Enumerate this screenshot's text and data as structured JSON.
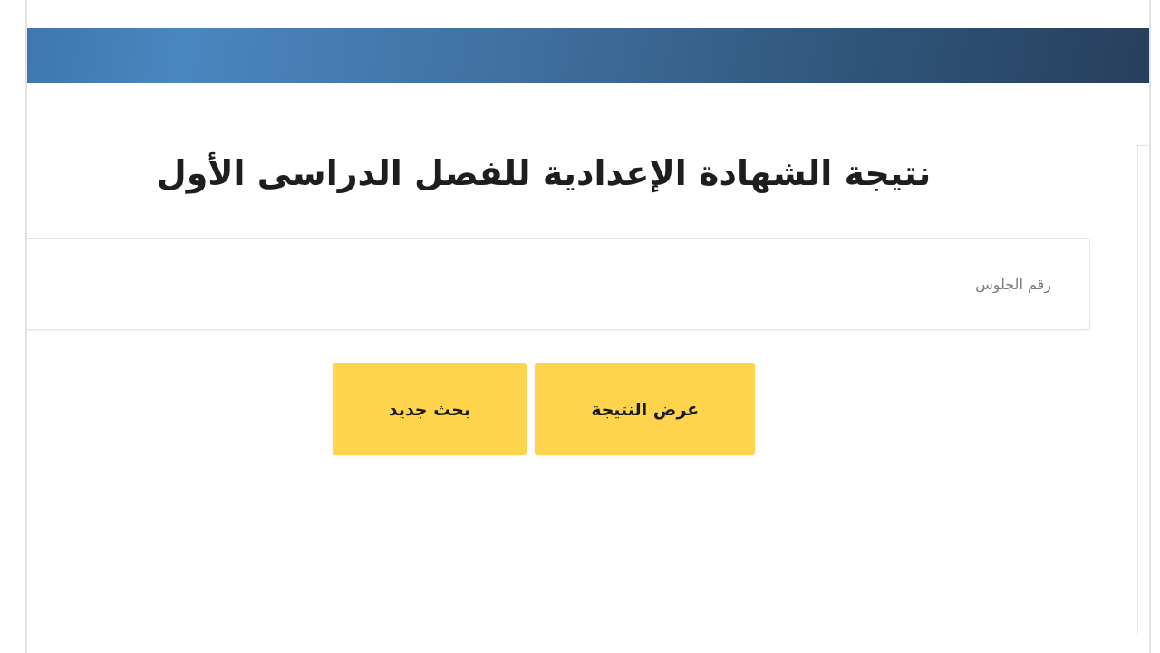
{
  "title": "نتيجة الشهادة الإعدادية للفصل الدراسى الأول",
  "seat_number_field": {
    "placeholder": "رقم الجلوس"
  },
  "buttons": [
    {
      "label": "عرض النتيجة"
    },
    {
      "label": "بحث جديد"
    }
  ]
}
